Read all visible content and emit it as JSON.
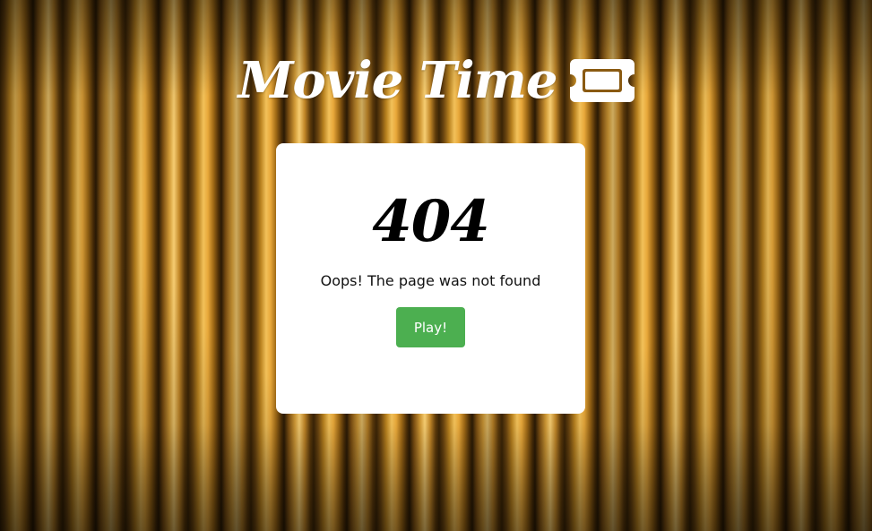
{
  "header": {
    "logo_text": "Movie Time",
    "logo_icon": "ticket-icon"
  },
  "error": {
    "code": "404",
    "message": "Oops! The page was not found",
    "button_label": "Play!"
  },
  "colors": {
    "button": "#4caf50",
    "card": "#ffffff",
    "logo": "#ffffff"
  }
}
